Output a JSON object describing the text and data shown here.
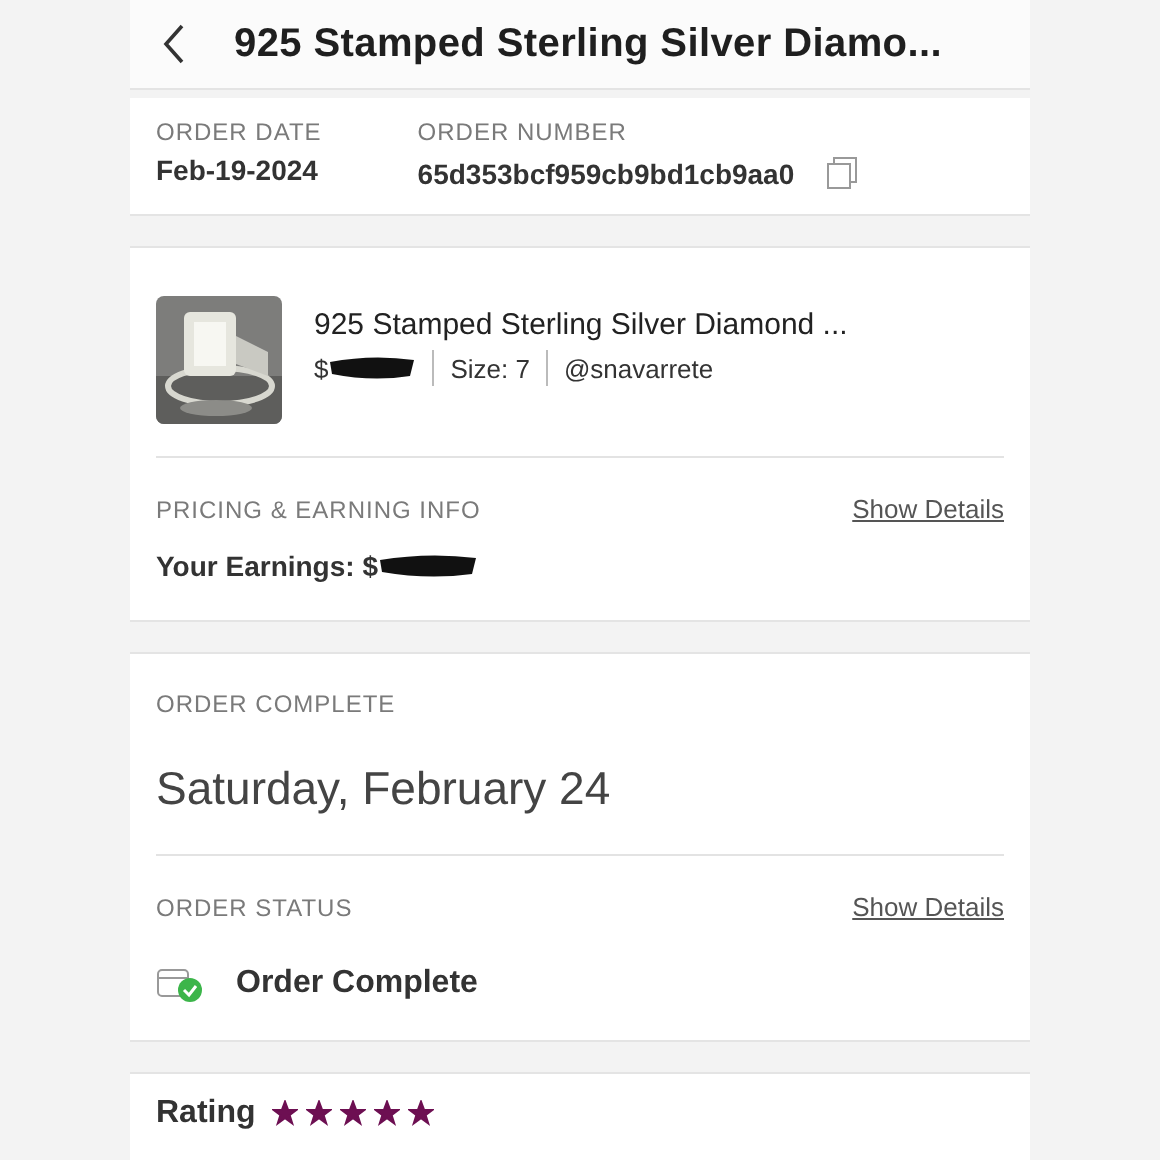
{
  "header": {
    "title": "925 Stamped Sterling Silver Diamo..."
  },
  "order_info": [
    {
      "label": "ORDER DATE",
      "value": "Feb-19-2024",
      "copyable": false
    },
    {
      "label": "ORDER NUMBER",
      "value": "65d353bcf959cb9bd1cb9aa0",
      "copyable": true
    }
  ],
  "product": {
    "title": "925 Stamped Sterling Silver Diamond ...",
    "price": "$",
    "size": "Size: 7",
    "seller": "@snavarrete"
  },
  "pricing": {
    "label": "PRICING & EARNING INFO",
    "link": "Show Details",
    "earnings": "Your Earnings: $"
  },
  "completion": {
    "label": "ORDER COMPLETE",
    "date": "Saturday, February 24"
  },
  "status": {
    "label": "ORDER STATUS",
    "link": "Show Details",
    "text": "Order Complete"
  },
  "rating": {
    "label": "Rating",
    "stars": 5
  }
}
